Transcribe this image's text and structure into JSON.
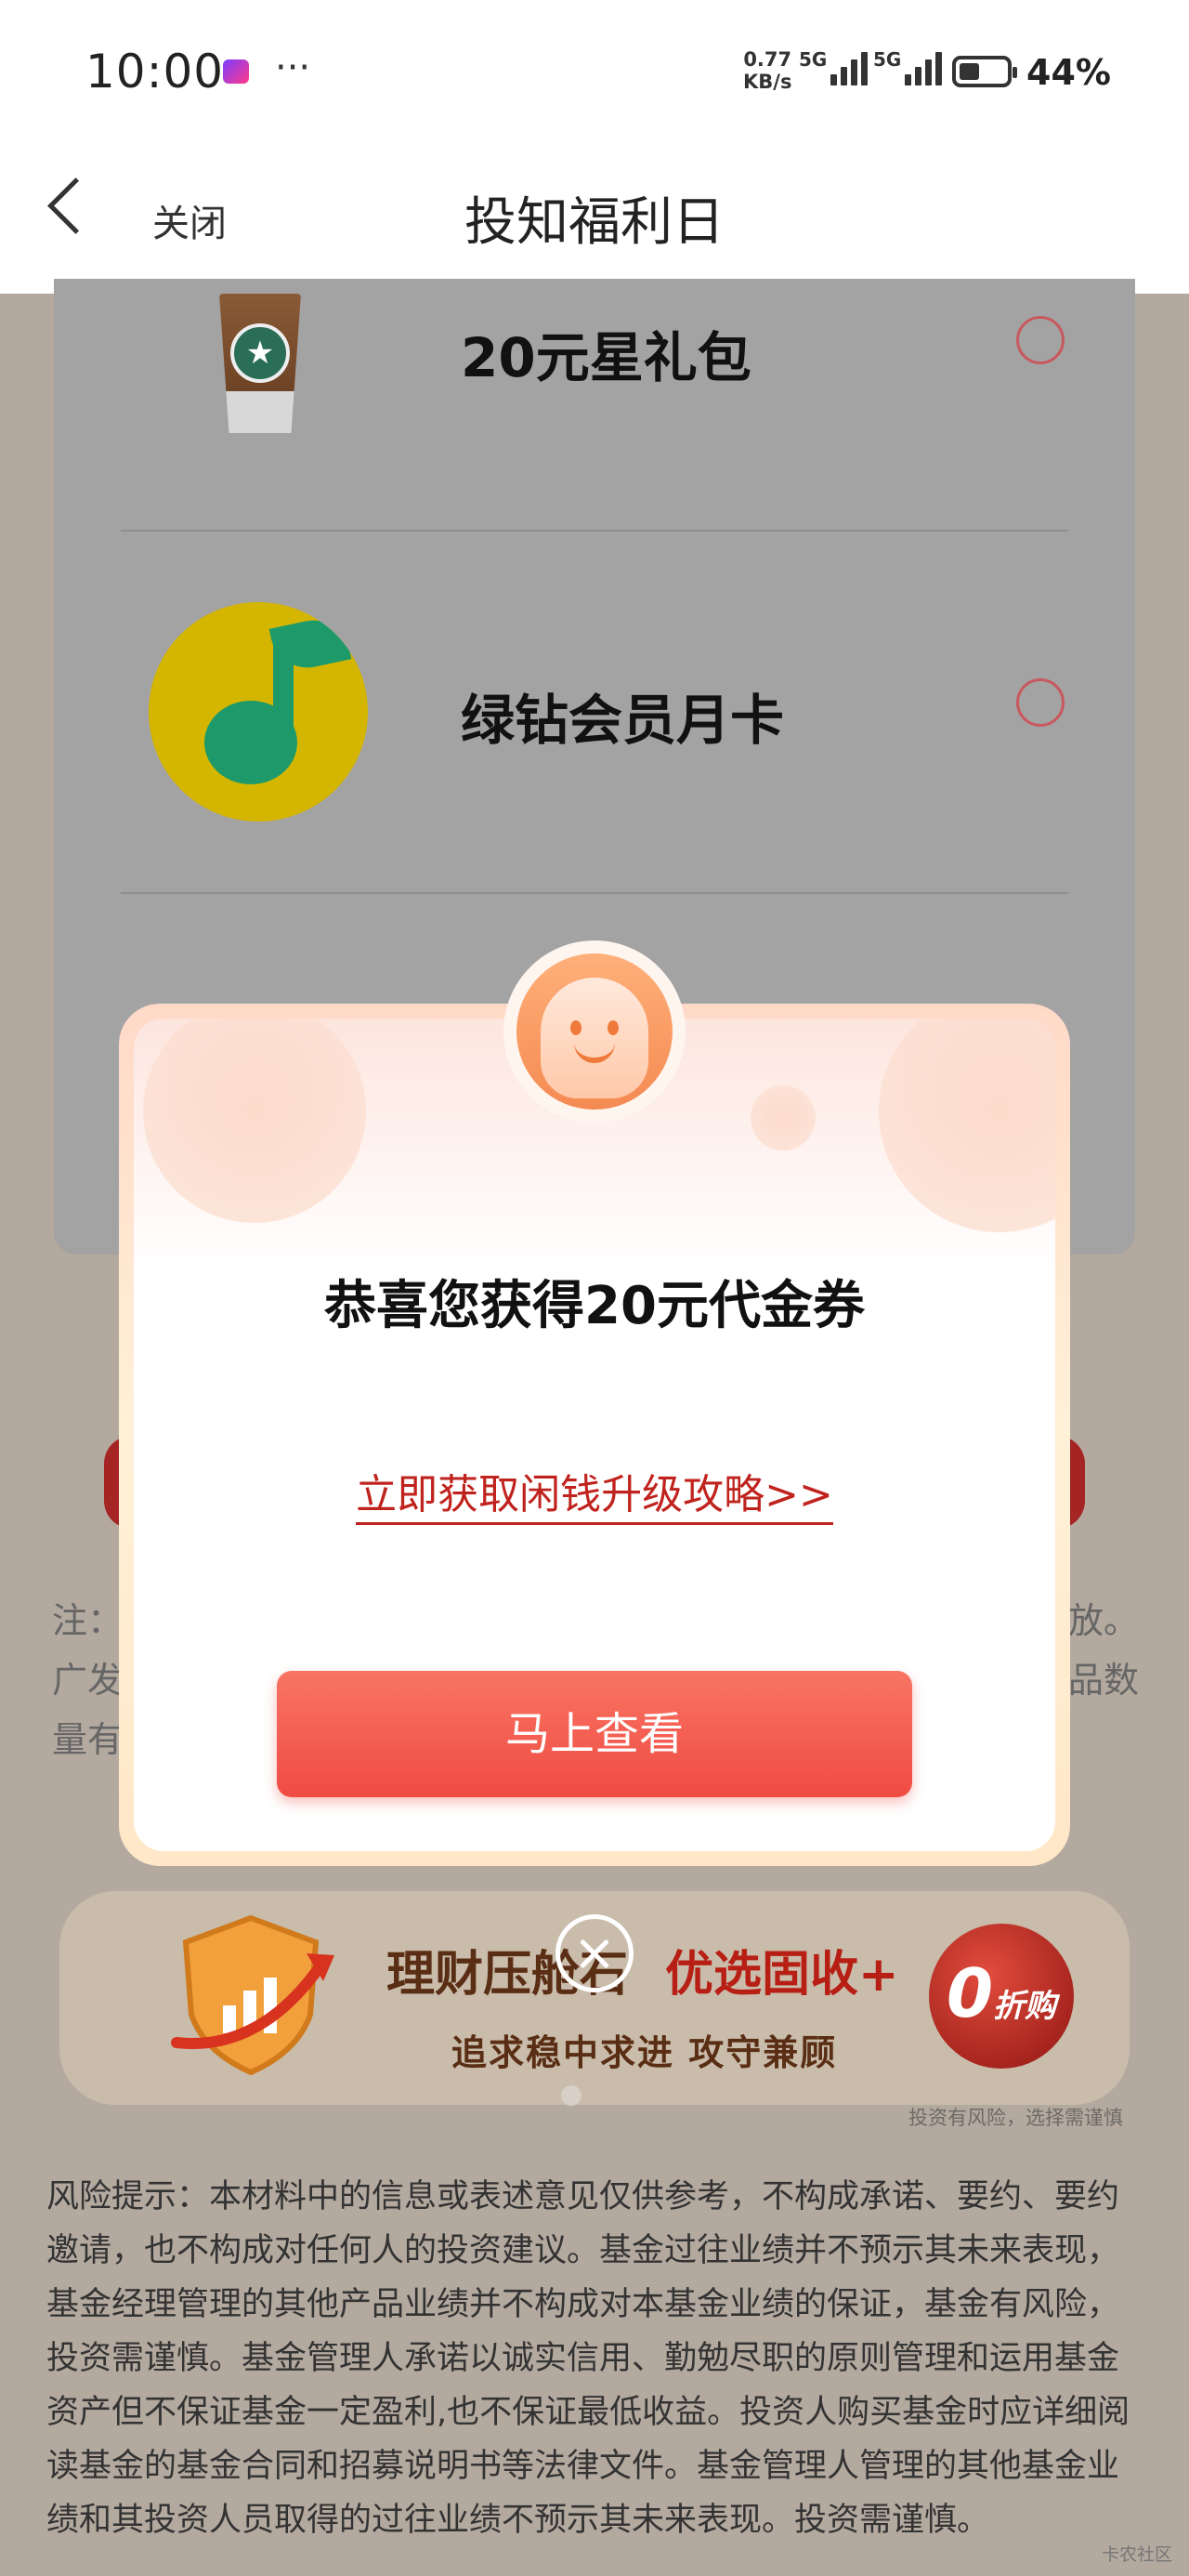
{
  "status_bar": {
    "time": "10:00",
    "dots": "···",
    "net_speed_value": "0.77",
    "net_speed_unit": "KB/s",
    "sim1": "5G",
    "sim2": "5G",
    "battery_percent": "44%",
    "battery_level": 0.44
  },
  "nav": {
    "close_label": "关闭",
    "title": "投知福利日"
  },
  "prize_list": [
    {
      "name": "20元星礼包",
      "icon": "coffee-cup-icon"
    },
    {
      "name": "绿钻会员月卡",
      "icon": "music-note-icon"
    }
  ],
  "background_note": {
    "line1_start": "注：",
    "line1_end": "放。",
    "line2_start": "广发",
    "line2_end": "品数",
    "line3_start": "量有"
  },
  "modal": {
    "title": "恭喜您获得20元代金券",
    "link": "立即获取闲钱升级攻略>>",
    "cta": "马上查看"
  },
  "banner": {
    "title_a": "理财压舱石",
    "title_b": "优选固收+",
    "subtitle": "追求稳中求进 攻守兼顾",
    "badge_number": "0",
    "badge_text": "折购",
    "risk_small": "投资有风险，选择需谨慎"
  },
  "risk_notice": "风险提示：本材料中的信息或表述意见仅供参考，不构成承诺、要约、要约邀请，也不构成对任何人的投资建议。基金过往业绩并不预示其未来表现，基金经理管理的其他产品业绩并不构成对本基金业绩的保证，基金有风险，投资需谨慎。基金管理人承诺以诚实信用、勤勉尽职的原则管理和运用基金资产但不保证基金一定盈利,也不保证最低收益。投资人购买基金时应详细阅读基金的基金合同和招募说明书等法律文件。基金管理人管理的其他基金业绩和其投资人员取得的过往业绩不预示其未来表现。投资需谨慎。",
  "watermark": "卡农社区",
  "colors": {
    "accent_red": "#ef4b43",
    "link_red": "#c0231d",
    "overlay": "#b3a99f"
  }
}
